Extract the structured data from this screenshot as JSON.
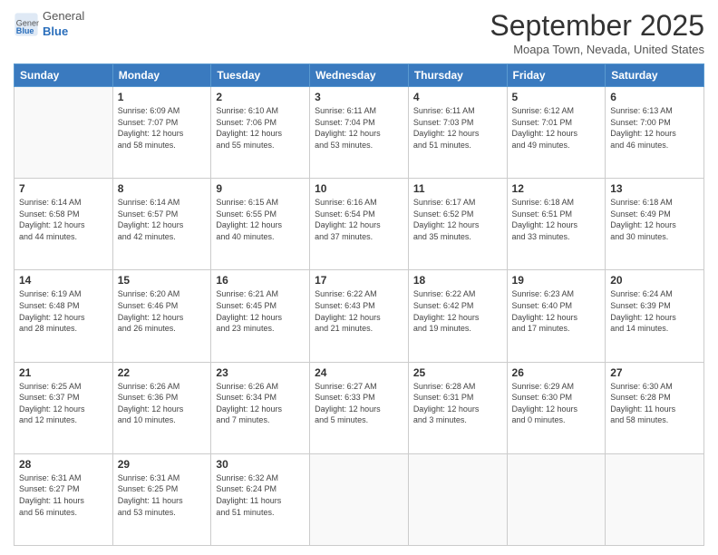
{
  "header": {
    "logo_general": "General",
    "logo_blue": "Blue",
    "month": "September 2025",
    "location": "Moapa Town, Nevada, United States"
  },
  "weekdays": [
    "Sunday",
    "Monday",
    "Tuesday",
    "Wednesday",
    "Thursday",
    "Friday",
    "Saturday"
  ],
  "weeks": [
    [
      {
        "day": "",
        "info": ""
      },
      {
        "day": "1",
        "info": "Sunrise: 6:09 AM\nSunset: 7:07 PM\nDaylight: 12 hours\nand 58 minutes."
      },
      {
        "day": "2",
        "info": "Sunrise: 6:10 AM\nSunset: 7:06 PM\nDaylight: 12 hours\nand 55 minutes."
      },
      {
        "day": "3",
        "info": "Sunrise: 6:11 AM\nSunset: 7:04 PM\nDaylight: 12 hours\nand 53 minutes."
      },
      {
        "day": "4",
        "info": "Sunrise: 6:11 AM\nSunset: 7:03 PM\nDaylight: 12 hours\nand 51 minutes."
      },
      {
        "day": "5",
        "info": "Sunrise: 6:12 AM\nSunset: 7:01 PM\nDaylight: 12 hours\nand 49 minutes."
      },
      {
        "day": "6",
        "info": "Sunrise: 6:13 AM\nSunset: 7:00 PM\nDaylight: 12 hours\nand 46 minutes."
      }
    ],
    [
      {
        "day": "7",
        "info": "Sunrise: 6:14 AM\nSunset: 6:58 PM\nDaylight: 12 hours\nand 44 minutes."
      },
      {
        "day": "8",
        "info": "Sunrise: 6:14 AM\nSunset: 6:57 PM\nDaylight: 12 hours\nand 42 minutes."
      },
      {
        "day": "9",
        "info": "Sunrise: 6:15 AM\nSunset: 6:55 PM\nDaylight: 12 hours\nand 40 minutes."
      },
      {
        "day": "10",
        "info": "Sunrise: 6:16 AM\nSunset: 6:54 PM\nDaylight: 12 hours\nand 37 minutes."
      },
      {
        "day": "11",
        "info": "Sunrise: 6:17 AM\nSunset: 6:52 PM\nDaylight: 12 hours\nand 35 minutes."
      },
      {
        "day": "12",
        "info": "Sunrise: 6:18 AM\nSunset: 6:51 PM\nDaylight: 12 hours\nand 33 minutes."
      },
      {
        "day": "13",
        "info": "Sunrise: 6:18 AM\nSunset: 6:49 PM\nDaylight: 12 hours\nand 30 minutes."
      }
    ],
    [
      {
        "day": "14",
        "info": "Sunrise: 6:19 AM\nSunset: 6:48 PM\nDaylight: 12 hours\nand 28 minutes."
      },
      {
        "day": "15",
        "info": "Sunrise: 6:20 AM\nSunset: 6:46 PM\nDaylight: 12 hours\nand 26 minutes."
      },
      {
        "day": "16",
        "info": "Sunrise: 6:21 AM\nSunset: 6:45 PM\nDaylight: 12 hours\nand 23 minutes."
      },
      {
        "day": "17",
        "info": "Sunrise: 6:22 AM\nSunset: 6:43 PM\nDaylight: 12 hours\nand 21 minutes."
      },
      {
        "day": "18",
        "info": "Sunrise: 6:22 AM\nSunset: 6:42 PM\nDaylight: 12 hours\nand 19 minutes."
      },
      {
        "day": "19",
        "info": "Sunrise: 6:23 AM\nSunset: 6:40 PM\nDaylight: 12 hours\nand 17 minutes."
      },
      {
        "day": "20",
        "info": "Sunrise: 6:24 AM\nSunset: 6:39 PM\nDaylight: 12 hours\nand 14 minutes."
      }
    ],
    [
      {
        "day": "21",
        "info": "Sunrise: 6:25 AM\nSunset: 6:37 PM\nDaylight: 12 hours\nand 12 minutes."
      },
      {
        "day": "22",
        "info": "Sunrise: 6:26 AM\nSunset: 6:36 PM\nDaylight: 12 hours\nand 10 minutes."
      },
      {
        "day": "23",
        "info": "Sunrise: 6:26 AM\nSunset: 6:34 PM\nDaylight: 12 hours\nand 7 minutes."
      },
      {
        "day": "24",
        "info": "Sunrise: 6:27 AM\nSunset: 6:33 PM\nDaylight: 12 hours\nand 5 minutes."
      },
      {
        "day": "25",
        "info": "Sunrise: 6:28 AM\nSunset: 6:31 PM\nDaylight: 12 hours\nand 3 minutes."
      },
      {
        "day": "26",
        "info": "Sunrise: 6:29 AM\nSunset: 6:30 PM\nDaylight: 12 hours\nand 0 minutes."
      },
      {
        "day": "27",
        "info": "Sunrise: 6:30 AM\nSunset: 6:28 PM\nDaylight: 11 hours\nand 58 minutes."
      }
    ],
    [
      {
        "day": "28",
        "info": "Sunrise: 6:31 AM\nSunset: 6:27 PM\nDaylight: 11 hours\nand 56 minutes."
      },
      {
        "day": "29",
        "info": "Sunrise: 6:31 AM\nSunset: 6:25 PM\nDaylight: 11 hours\nand 53 minutes."
      },
      {
        "day": "30",
        "info": "Sunrise: 6:32 AM\nSunset: 6:24 PM\nDaylight: 11 hours\nand 51 minutes."
      },
      {
        "day": "",
        "info": ""
      },
      {
        "day": "",
        "info": ""
      },
      {
        "day": "",
        "info": ""
      },
      {
        "day": "",
        "info": ""
      }
    ]
  ]
}
